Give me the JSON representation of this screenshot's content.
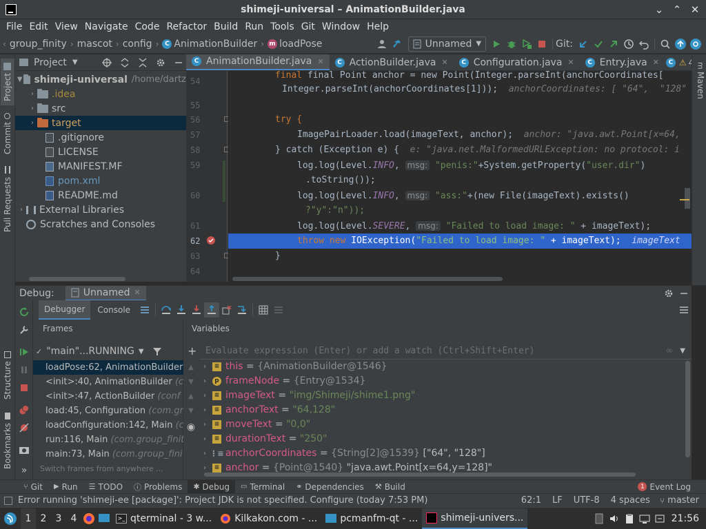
{
  "window": {
    "title": "shimeji-universal – AnimationBuilder.java",
    "controls": [
      "minimize",
      "maximize",
      "close"
    ]
  },
  "menu": [
    "File",
    "Edit",
    "View",
    "Navigate",
    "Code",
    "Refactor",
    "Build",
    "Run",
    "Tools",
    "Git",
    "Window",
    "Help"
  ],
  "breadcrumbs": [
    "group_finity",
    "mascot",
    "config",
    "AnimationBuilder",
    "loadPose"
  ],
  "toolbar": {
    "run_config": "Unnamed",
    "git_label": "Git:"
  },
  "left_strip": [
    "Project",
    "Commit",
    "Pull Requests",
    "Structure",
    "Bookmarks"
  ],
  "right_strip": [
    "Maven"
  ],
  "project": {
    "header": "Project",
    "tree": [
      {
        "label": "shimeji-universal",
        "extra": "/home/dartz",
        "bold": true
      },
      {
        "label": ".idea"
      },
      {
        "label": "src"
      },
      {
        "label": "target"
      },
      {
        "label": ".gitignore"
      },
      {
        "label": "LICENSE"
      },
      {
        "label": "MANIFEST.MF"
      },
      {
        "label": "pom.xml"
      },
      {
        "label": "README.md"
      },
      {
        "label": "External Libraries"
      },
      {
        "label": "Scratches and Consoles"
      }
    ]
  },
  "editor": {
    "tabs": [
      "AnimationBuilder.java",
      "ActionBuilder.java",
      "Configuration.java",
      "Entry.java"
    ],
    "warnings": "4",
    "weak_warnings": "4",
    "line_numbers": [
      "54",
      "55",
      "56",
      "57",
      "58",
      "59",
      "60",
      "61",
      "62",
      "63",
      "64"
    ],
    "lines": {
      "l0a": "final Point anchor = new Point(Integer.parseInt(anchorCoordinates[",
      "l0b_code": "Integer.parseInt(anchorCoordinates[1]));",
      "l0b_hint": "anchorCoordinates: [ \"64\",  \"128\" ]",
      "try": "try {",
      "load_pre": "ImagePairLoader.load(imageText, anchor);",
      "load_hint": "anchor: \"java.awt.Point[x=64,",
      "catch_code": "} catch (Exception e) {",
      "catch_hint": "e: \"java.net.MalformedURLException: no protocol: i",
      "log1a": "log.log(Level.",
      "info": "INFO",
      "msg": "msg:",
      "penis": "\"penis:\"",
      "log1b": "+System.getProperty(",
      "userdir": "\"user.dir\"",
      "log1c": ")",
      "tostring": ".toString());",
      "ass": "\"ass:\"",
      "log2b": "+(new File(imageText).exists()",
      "yn": "?\"y\":\"n\"));",
      "severe": "SEVERE",
      "failed": "\"Failed to load image: \"",
      "plus_img": " + imageText);",
      "throw_kw": "throw new",
      "throw_mid": " IOException(",
      "throw_hint": "imageText",
      "close_brace": "}"
    }
  },
  "debug": {
    "label": "Debug:",
    "session": "Unnamed",
    "tabs": [
      "Debugger",
      "Console"
    ],
    "frames_label": "Frames",
    "variables_label": "Variables",
    "thread": "\"main\"...RUNNING",
    "eval_placeholder": "Evaluate expression (Enter) or add a watch (Ctrl+Shift+Enter)",
    "switch_hint": "Switch frames from anywhere ...",
    "frames": [
      {
        "name": "loadPose:62, AnimationBuilder",
        "pkg": "",
        "sel": true
      },
      {
        "name": "<init>:40, AnimationBuilder",
        "pkg": "(c"
      },
      {
        "name": "<init>:47, ActionBuilder",
        "pkg": "(conf"
      },
      {
        "name": "load:45, Configuration",
        "pkg": "(com.gr"
      },
      {
        "name": "loadConfiguration:142, Main",
        "pkg": "(co"
      },
      {
        "name": "run:116, Main",
        "pkg": "(com.group_finit"
      },
      {
        "name": "main:73, Main",
        "pkg": "(com.group_fini"
      }
    ],
    "variables": [
      {
        "name": "this",
        "ref": "{AnimationBuilder@1546}",
        "val": "",
        "icon": "field"
      },
      {
        "name": "frameNode",
        "ref": "{Entry@1534}",
        "val": "",
        "icon": "param"
      },
      {
        "name": "imageText",
        "ref": "",
        "val": "\"img/Shimeji/shime1.png\"",
        "icon": "field"
      },
      {
        "name": "anchorText",
        "ref": "",
        "val": "\"64,128\"",
        "icon": "field"
      },
      {
        "name": "moveText",
        "ref": "",
        "val": "\"0,0\"",
        "icon": "field"
      },
      {
        "name": "durationText",
        "ref": "",
        "val": "\"250\"",
        "icon": "field"
      },
      {
        "name": "anchorCoordinates",
        "ref": "{String[2]@1539}",
        "val": "[\"64\", \"128\"]",
        "icon": "array"
      },
      {
        "name": "anchor",
        "ref": "{Point@1540}",
        "val": "\"java.awt.Point[x=64,y=128]\"",
        "icon": "field"
      }
    ]
  },
  "bottom_tools": [
    "Git",
    "Run",
    "TODO",
    "Problems",
    "Debug",
    "Terminal",
    "Dependencies",
    "Build"
  ],
  "event_log": {
    "label": "Event Log",
    "count": "1"
  },
  "status": {
    "message": "Error running 'shimeji-ee [package]': Project JDK is not specified. Configure (today 7:53 PM)",
    "position": "62:1",
    "line_sep": "LF",
    "encoding": "UTF-8",
    "indent": "4 spaces",
    "branch": "master"
  },
  "taskbar": {
    "workspaces": [
      "1",
      "2",
      "3",
      "4"
    ],
    "tasks": [
      "qterminal - 3 w...",
      "Kilkakon.com - ...",
      "pcmanfm-qt - ...",
      "shimeji-univers..."
    ],
    "clock": "21:56"
  },
  "colors": {
    "accent": "#4a88c7",
    "selection": "#2f65ca",
    "breakpoint": "#c75450",
    "keyword": "#cc7832",
    "string": "#6a8759"
  }
}
